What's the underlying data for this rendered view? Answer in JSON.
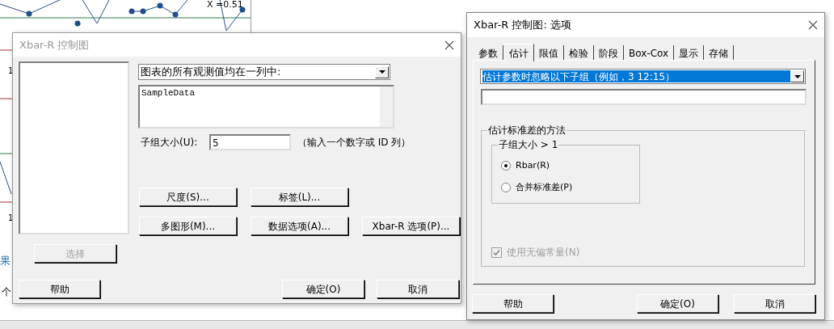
{
  "background": {
    "chart_label": "X =0.51",
    "axis_labels": [
      "1",
      "1"
    ],
    "fragments": [
      "果",
      "个"
    ]
  },
  "main_dialog": {
    "title": "Xbar-R 控制图",
    "layout_dropdown": {
      "value": "图表的所有观测值均在一列中:"
    },
    "columns_field": {
      "value": "SampleData"
    },
    "subgroup": {
      "label": "子组大小(U):",
      "value": "5",
      "hint": "（输入一个数字或 ID 列）"
    },
    "option_buttons": [
      {
        "label": "尺度(S)..."
      },
      {
        "label": "标签(L)..."
      },
      {
        "label": "多图形(M)..."
      },
      {
        "label": "数据选项(A)..."
      },
      {
        "label": "Xbar-R 选项(P)..."
      }
    ],
    "select_button": {
      "label": "选择",
      "disabled": true
    },
    "help_button": "帮助",
    "ok_button": "确定(O)",
    "cancel_button": "取消"
  },
  "options_dialog": {
    "title": "Xbar-R 控制图: 选项",
    "tabs": [
      {
        "label": "参数",
        "selected": false
      },
      {
        "label": "估计",
        "selected": true
      },
      {
        "label": "限值",
        "selected": false
      },
      {
        "label": "检验",
        "selected": false
      },
      {
        "label": "阶段",
        "selected": false
      },
      {
        "label": "Box-Cox",
        "selected": false
      },
      {
        "label": "显示",
        "selected": false
      },
      {
        "label": "存储",
        "selected": false
      }
    ],
    "ignore_dropdown": {
      "value": "估计参数时忽略以下子组（例如，3 12:15）",
      "selected": true
    },
    "method_group": {
      "title": "估计标准差的方法",
      "subgroup_title": "子组大小 > 1",
      "options": [
        {
          "label": "Rbar(R)",
          "selected": true
        },
        {
          "label": "合并标准差(P)",
          "selected": false
        }
      ],
      "unbiased": {
        "label": "使用无偏常量(N)",
        "checked": true,
        "disabled": true
      }
    },
    "help_button": "帮助",
    "ok_button": "确定(O)",
    "cancel_button": "取消"
  }
}
